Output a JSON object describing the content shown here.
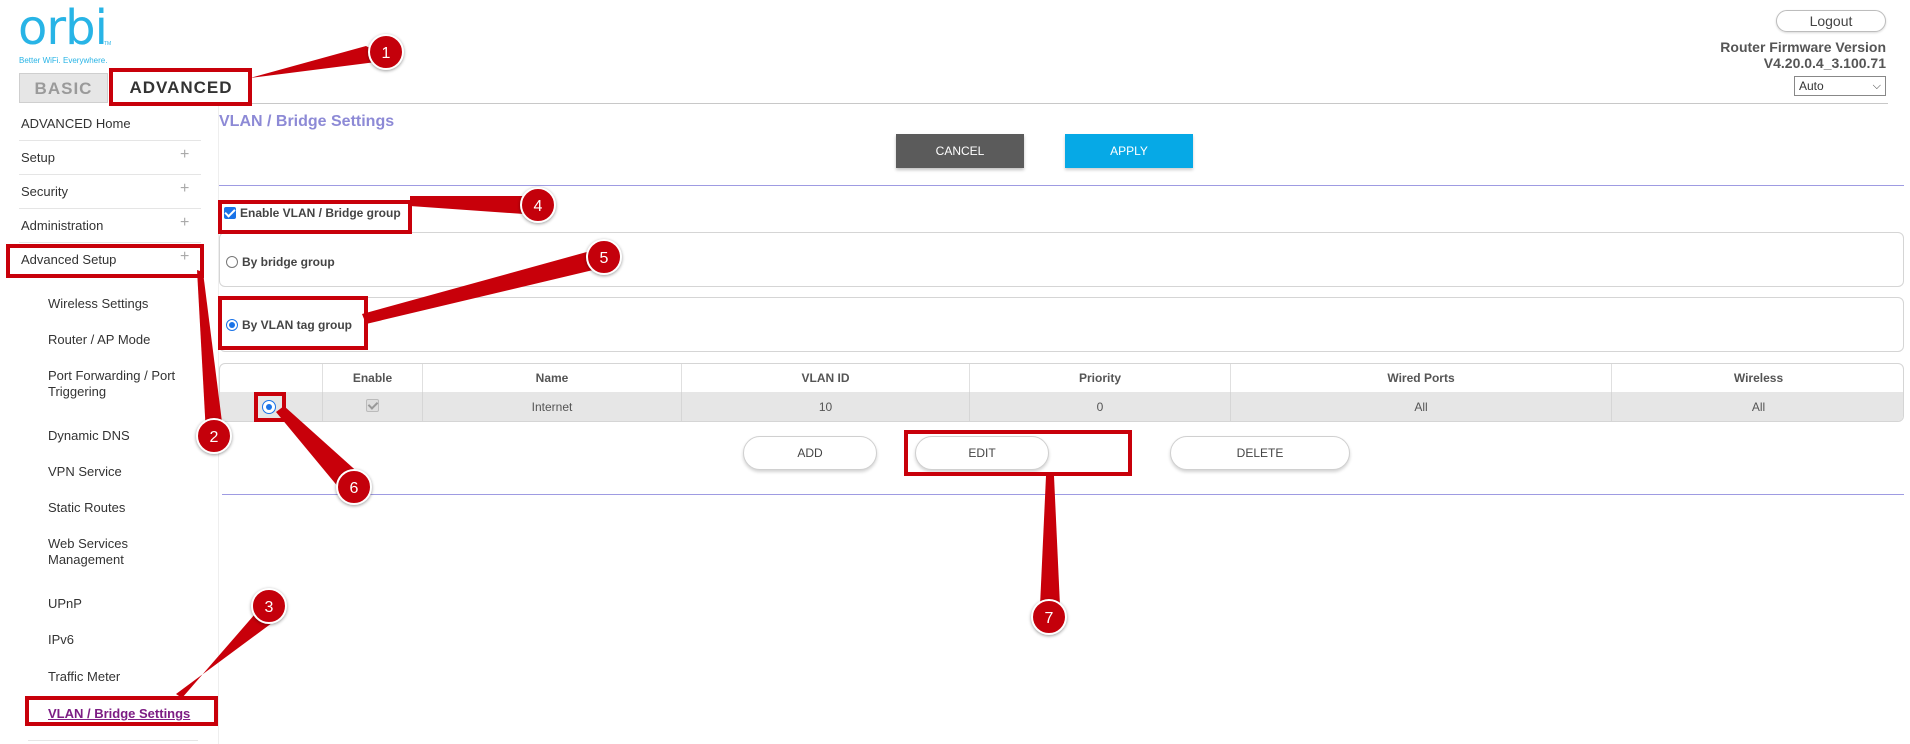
{
  "header": {
    "logo_text": "orbi",
    "logo_tagline": "Better WiFi. Everywhere.",
    "logo_tm": "TM",
    "logout_label": "Logout",
    "firmware_label": "Router Firmware Version",
    "firmware_version": "V4.20.0.4_3.100.71",
    "language_selected": "Auto"
  },
  "tabs": {
    "basic": "BASIC",
    "advanced": "ADVANCED"
  },
  "sidebar": {
    "items": [
      {
        "label": "ADVANCED Home",
        "expandable": false
      },
      {
        "label": "Setup",
        "expandable": true
      },
      {
        "label": "Security",
        "expandable": true
      },
      {
        "label": "Administration",
        "expandable": true
      },
      {
        "label": "Advanced Setup",
        "expandable": true
      }
    ],
    "plus_glyph": "+",
    "subitems": [
      "Wireless Settings",
      "Router / AP Mode",
      "Port Forwarding / Port Triggering",
      "Dynamic DNS",
      "VPN Service",
      "Static Routes",
      "Web Services Management",
      "UPnP",
      "IPv6",
      "Traffic Meter"
    ],
    "active_subitem": "VLAN / Bridge Settings"
  },
  "main": {
    "title": "VLAN / Bridge Settings",
    "cancel_label": "CANCEL",
    "apply_label": "APPLY",
    "enable_label": "Enable VLAN / Bridge group",
    "enable_checked": true,
    "option_bridge": "By bridge group",
    "option_vlan": "By VLAN tag group",
    "selected_option": "vlan",
    "table": {
      "headers": [
        "",
        "Enable",
        "Name",
        "VLAN ID",
        "Priority",
        "Wired Ports",
        "Wireless"
      ],
      "rows": [
        {
          "selected": true,
          "enabled": true,
          "name": "Internet",
          "vlan_id": "10",
          "priority": "0",
          "wired_ports": "All",
          "wireless": "All"
        }
      ]
    },
    "add_label": "ADD",
    "edit_label": "EDIT",
    "delete_label": "DELETE"
  },
  "annotations": {
    "badges": [
      "1",
      "2",
      "3",
      "4",
      "5",
      "6",
      "7"
    ],
    "color": "#c8000a"
  },
  "colors": {
    "brand": "#28b4e6",
    "title": "#8d8ad6",
    "apply": "#06a9e6",
    "cancel": "#5b5b5b",
    "active_link": "#7d1d84"
  }
}
